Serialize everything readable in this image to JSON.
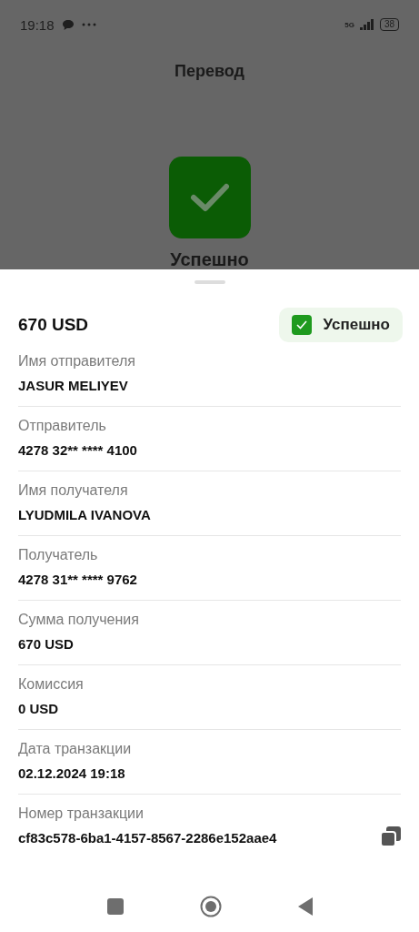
{
  "status_bar": {
    "time": "19:18",
    "network": "5G",
    "battery": "38"
  },
  "header": {
    "title": "Перевод"
  },
  "result": {
    "status": "Успешно"
  },
  "sheet": {
    "amount": "670 USD",
    "badge": {
      "label": "Успешно",
      "checked": true
    },
    "fields": [
      {
        "kind": "text",
        "label": "Имя отправителя",
        "value": "JASUR MELIYEV"
      },
      {
        "kind": "text",
        "label": "Отправитель",
        "value": "4278 32** **** 4100"
      },
      {
        "kind": "text",
        "label": "Имя получателя",
        "value": "LYUDMILA IVANOVA"
      },
      {
        "kind": "text",
        "label": "Получатель",
        "value": "4278 31** **** 9762"
      },
      {
        "kind": "text",
        "label": "Сумма получения",
        "value": "670 USD"
      },
      {
        "kind": "text",
        "label": "Комиссия",
        "value": "0 USD"
      },
      {
        "kind": "text",
        "label": "Дата транзакции",
        "value": "02.12.2024 19:18"
      },
      {
        "kind": "copy",
        "label": "Номер транзакции",
        "value": "cf83c578-6ba1-4157-8567-2286e152aae4"
      }
    ]
  }
}
